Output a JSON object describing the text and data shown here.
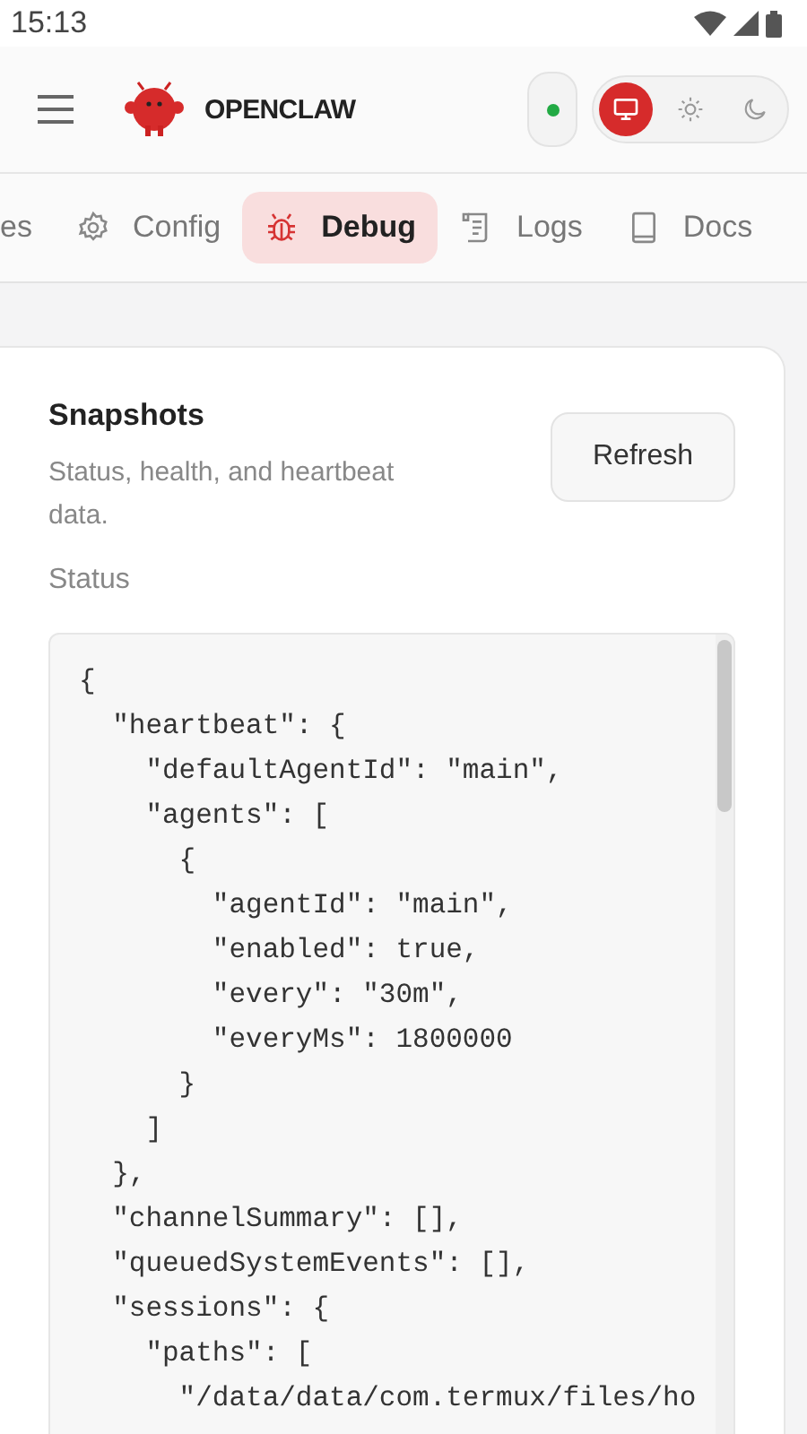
{
  "status_bar": {
    "time": "15:13"
  },
  "header": {
    "brand": "OPENCLAW",
    "connected": true,
    "theme_options": [
      {
        "selected": true
      },
      {
        "selected": false
      },
      {
        "selected": false
      }
    ]
  },
  "tabs": [
    {
      "label": "es",
      "selected": false
    },
    {
      "label": "Config",
      "selected": false
    },
    {
      "label": "Debug",
      "selected": true
    },
    {
      "label": "Logs",
      "selected": false
    },
    {
      "label": "Docs",
      "selected": false
    }
  ],
  "card": {
    "title": "Snapshots",
    "subtitle": "Status, health, and heartbeat data.",
    "button": "Refresh",
    "section_label": "Status",
    "code_lines": [
      "{",
      "  \"heartbeat\": {",
      "    \"defaultAgentId\": \"main\",",
      "    \"agents\": [",
      "      {",
      "        \"agentId\": \"main\",",
      "        \"enabled\": true,",
      "        \"every\": \"30m\",",
      "        \"everyMs\": 1800000",
      "      }",
      "    ]",
      "  },",
      "  \"channelSummary\": [],",
      "  \"queuedSystemEvents\": [],",
      "  \"sessions\": {",
      "    \"paths\": [",
      "      \"/data/data/com.termux/files/ho"
    ]
  }
}
